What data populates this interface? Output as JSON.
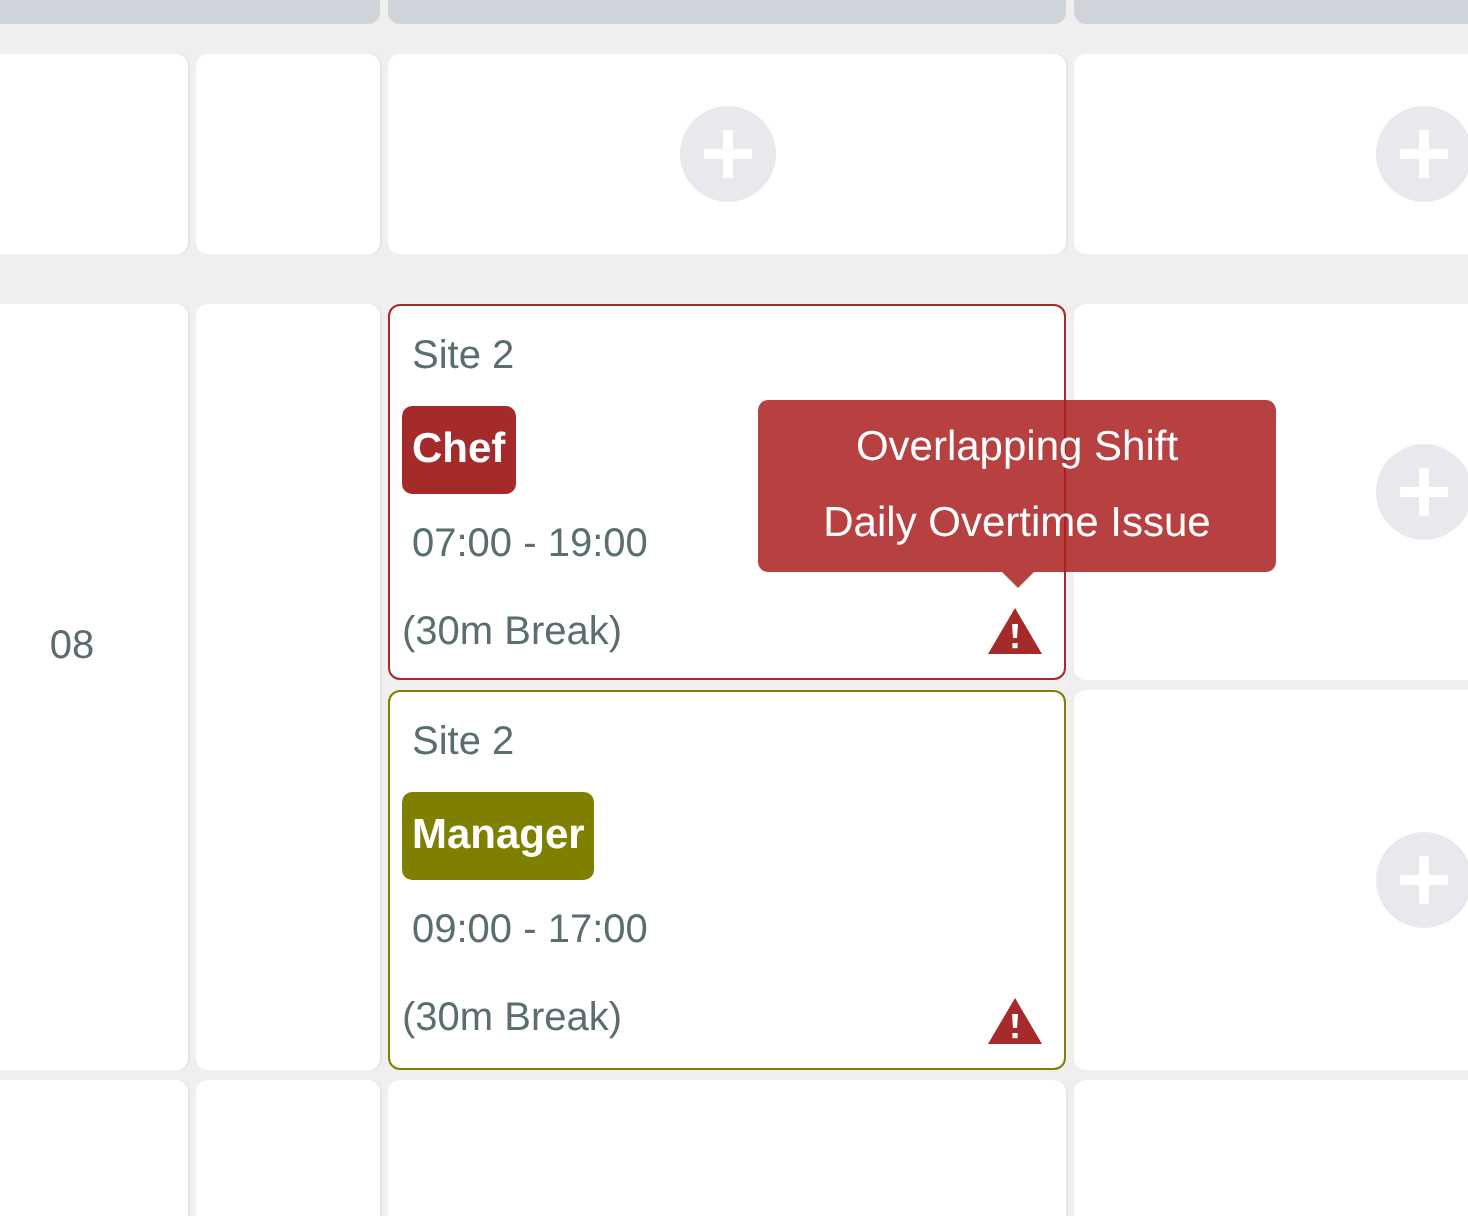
{
  "rows": [
    {
      "kind": "open",
      "cells": [
        {
          "kind": "empty"
        },
        {
          "kind": "empty"
        },
        {
          "kind": "add"
        },
        {
          "kind": "add"
        }
      ]
    },
    {
      "kind": "employee",
      "label": "08",
      "lines": [
        {
          "shift": {
            "site": "Site 2",
            "role": "Chef",
            "color": "#a52a2a",
            "time": "07:00 - 19:00",
            "break": "(30m Break)",
            "warning": true,
            "tooltip": [
              "Overlapping Shift",
              "Daily Overtime Issue"
            ]
          },
          "add": true
        },
        {
          "shift": {
            "site": "Site 2",
            "role": "Manager",
            "color": "#808000",
            "time": "09:00 - 17:00",
            "break": "(30m Break)",
            "warning": true
          },
          "add": true
        }
      ]
    },
    {
      "kind": "blank",
      "cells": [
        {
          "kind": "empty"
        },
        {
          "kind": "empty"
        },
        {
          "kind": "empty"
        },
        {
          "kind": "empty"
        }
      ]
    }
  ]
}
